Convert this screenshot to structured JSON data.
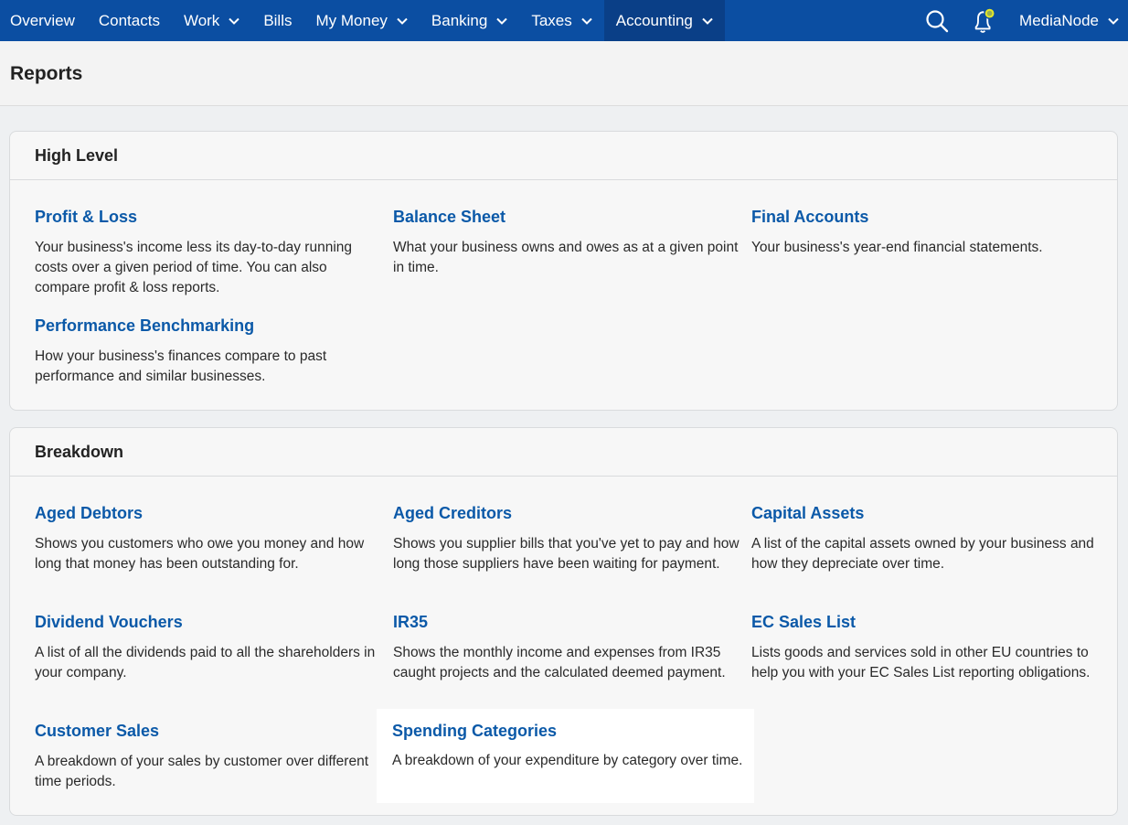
{
  "nav": {
    "items": [
      {
        "label": "Overview",
        "dropdown": false,
        "active": false
      },
      {
        "label": "Contacts",
        "dropdown": false,
        "active": false
      },
      {
        "label": "Work",
        "dropdown": true,
        "active": false
      },
      {
        "label": "Bills",
        "dropdown": false,
        "active": false
      },
      {
        "label": "My Money",
        "dropdown": true,
        "active": false
      },
      {
        "label": "Banking",
        "dropdown": true,
        "active": false
      },
      {
        "label": "Taxes",
        "dropdown": true,
        "active": false
      },
      {
        "label": "Accounting",
        "dropdown": true,
        "active": true
      }
    ],
    "search_icon": "search-icon",
    "notification_icon": "bell-icon",
    "account_label": "MediaNode"
  },
  "page": {
    "title": "Reports"
  },
  "sections": {
    "high_level": {
      "title": "High Level",
      "reports": [
        {
          "title": "Profit & Loss",
          "desc": "Your business's income less its day-to-day running costs over a given period of time. You can also compare profit & loss reports."
        },
        {
          "title": "Balance Sheet",
          "desc": "What your business owns and owes as at a given point in time."
        },
        {
          "title": "Final Accounts",
          "desc": "Your business's year-end financial statements."
        },
        {
          "title": "Performance Benchmarking",
          "desc": "How your business's finances compare to past performance and similar businesses."
        }
      ]
    },
    "breakdown": {
      "title": "Breakdown",
      "reports": [
        {
          "title": "Aged Debtors",
          "desc": "Shows you customers who owe you money and how long that money has been outstanding for."
        },
        {
          "title": "Aged Creditors",
          "desc": "Shows you supplier bills that you've yet to pay and how long those suppliers have been waiting for payment."
        },
        {
          "title": "Capital Assets",
          "desc": "A list of the capital assets owned by your business and how they depreciate over time."
        },
        {
          "title": "Dividend Vouchers",
          "desc": "A list of all the dividends paid to all the shareholders in your company."
        },
        {
          "title": "IR35",
          "desc": "Shows the monthly income and expenses from IR35 caught projects and the calculated deemed payment."
        },
        {
          "title": "EC Sales List",
          "desc": "Lists goods and services sold in other EU countries to help you with your EC Sales List reporting obligations."
        },
        {
          "title": "Customer Sales",
          "desc": "A breakdown of your sales by customer over different time periods."
        },
        {
          "title": "Spending Categories",
          "desc": "A breakdown of your expenditure by category over time."
        }
      ]
    }
  },
  "colors": {
    "nav_bg": "#0b4ea2",
    "nav_active": "#0a3f87",
    "link": "#0b59a8",
    "notification_dot": "#e3e62a"
  }
}
